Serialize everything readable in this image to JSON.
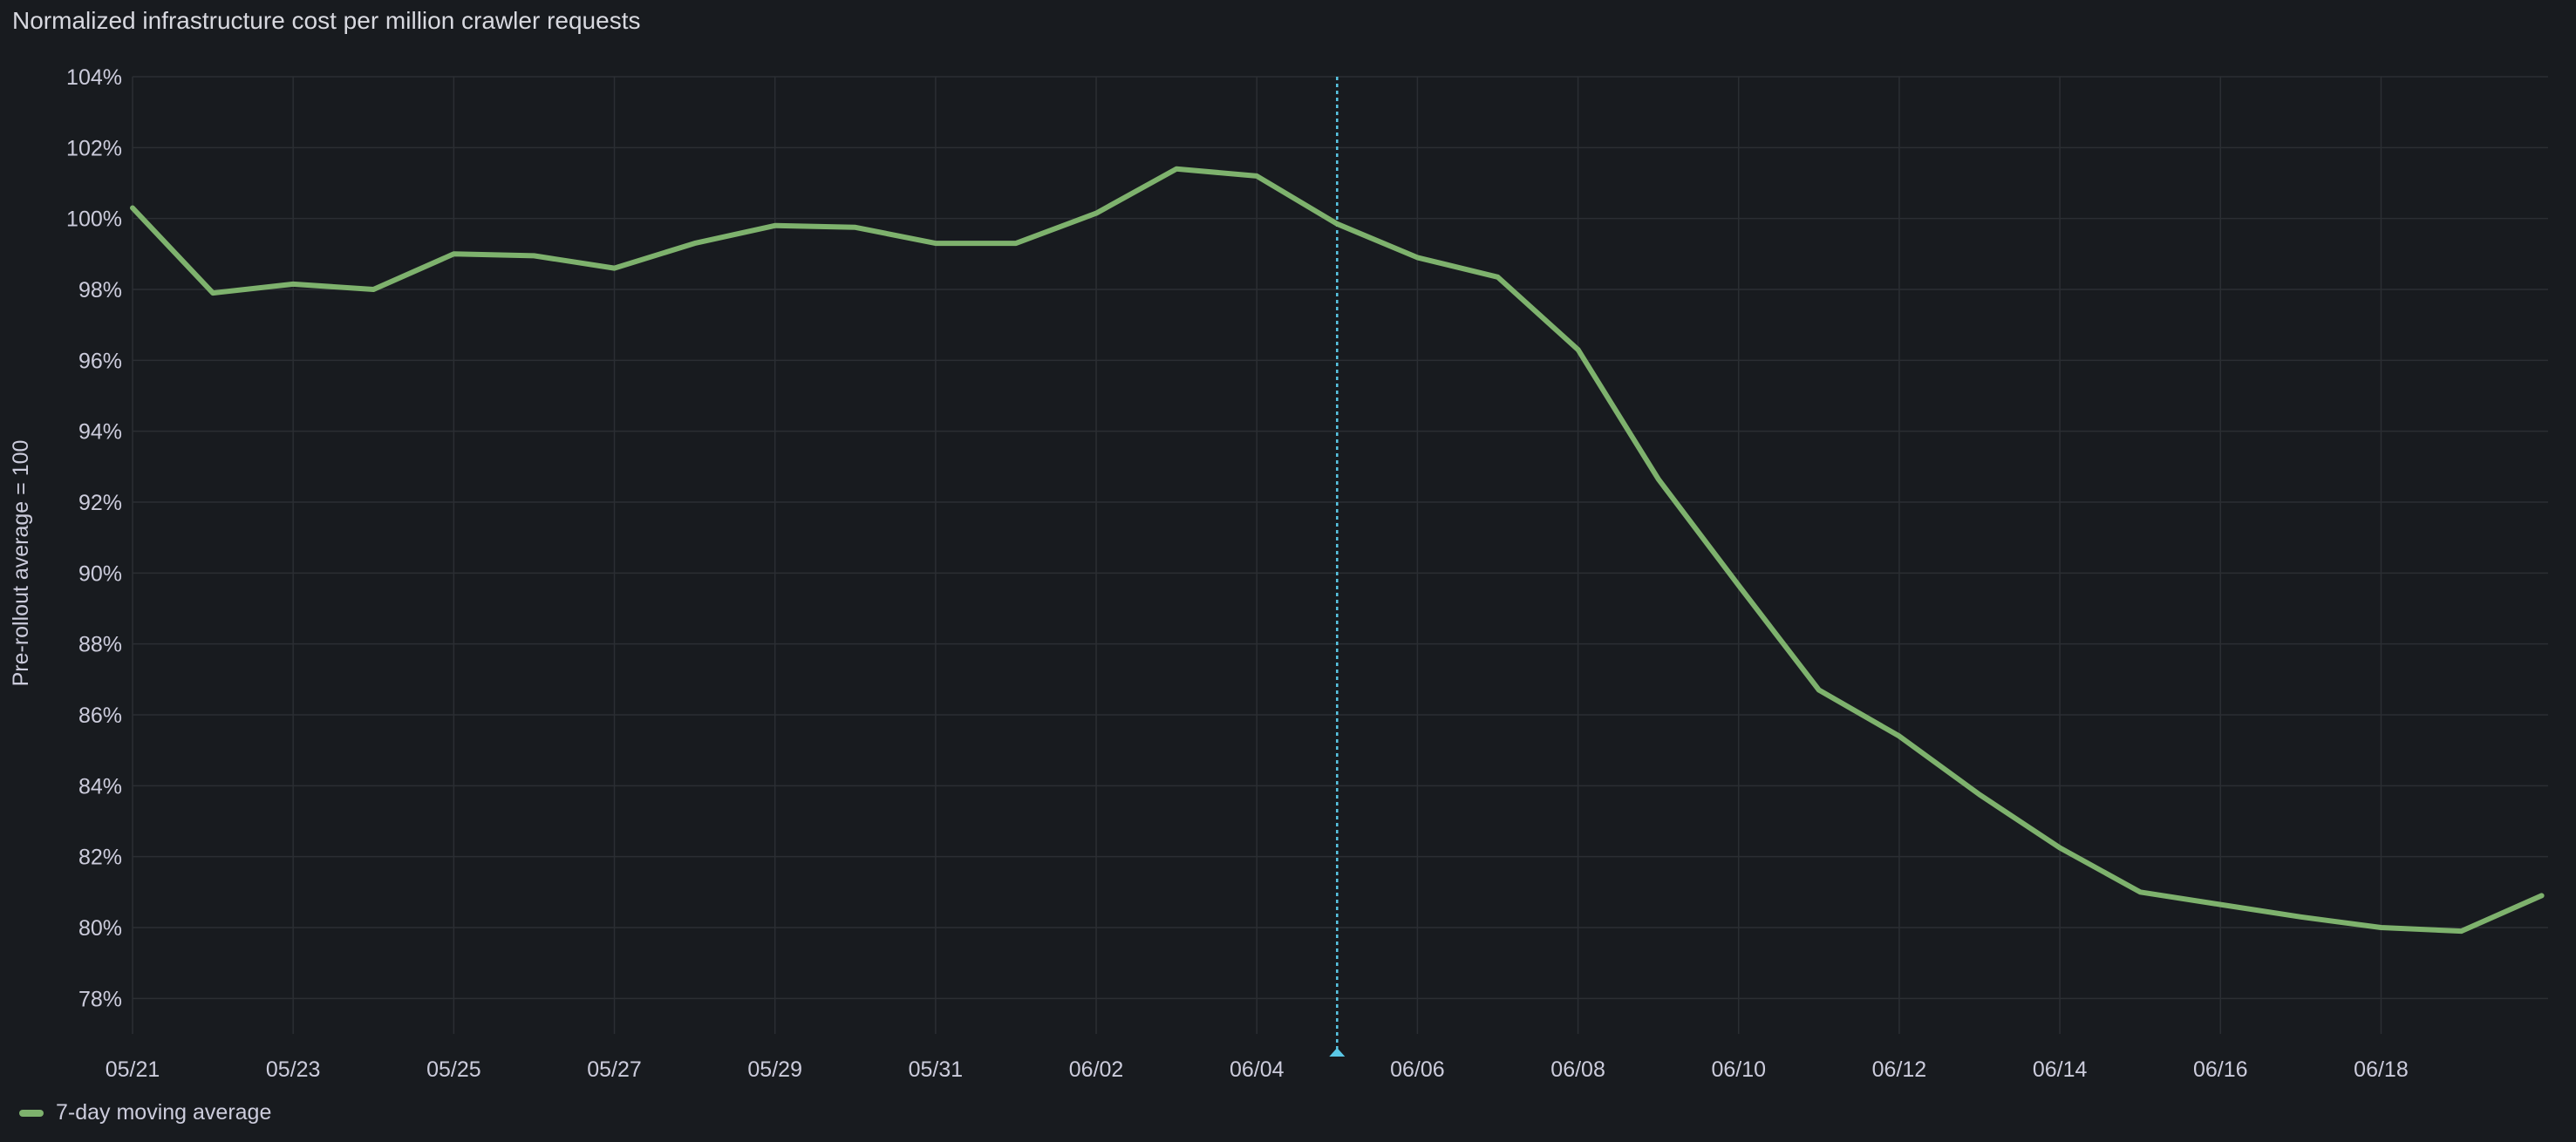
{
  "panel": {
    "title": "Normalized infrastructure cost per million crawler requests"
  },
  "colors": {
    "background": "#181b1f",
    "grid": "#2b2e33",
    "text": "#ccccdc",
    "series": "#7eb26d",
    "annotation": "#5ac8e6"
  },
  "chart_data": {
    "type": "line",
    "title": "Normalized infrastructure cost per million crawler requests",
    "ylabel": "Pre-rollout average = 100",
    "xlabel": "",
    "ylim": [
      77,
      104
    ],
    "y_ticks": [
      78,
      80,
      82,
      84,
      86,
      88,
      90,
      92,
      94,
      96,
      98,
      100,
      102,
      104
    ],
    "y_tick_suffix": "%",
    "x_tick_labels": [
      "05/21",
      "05/23",
      "05/25",
      "05/27",
      "05/29",
      "05/31",
      "06/02",
      "06/04",
      "06/06",
      "06/08",
      "06/10",
      "06/12",
      "06/14",
      "06/16",
      "06/18"
    ],
    "x_tick_indices": [
      0,
      2,
      4,
      6,
      8,
      10,
      12,
      14,
      16,
      18,
      20,
      22,
      24,
      26,
      28
    ],
    "x": [
      "05/21",
      "05/22",
      "05/23",
      "05/24",
      "05/25",
      "05/26",
      "05/27",
      "05/28",
      "05/29",
      "05/30",
      "05/31",
      "06/01",
      "06/02",
      "06/03",
      "06/04",
      "06/05",
      "06/06",
      "06/07",
      "06/08",
      "06/09",
      "06/10",
      "06/11",
      "06/12",
      "06/13",
      "06/14",
      "06/15",
      "06/16",
      "06/17",
      "06/18",
      "06/19",
      "06/20"
    ],
    "series": [
      {
        "name": "7-day moving average",
        "values": [
          100.3,
          97.9,
          98.15,
          98.0,
          99.0,
          98.95,
          98.6,
          99.3,
          99.8,
          99.75,
          99.3,
          99.3,
          100.15,
          101.4,
          101.2,
          99.85,
          98.9,
          98.35,
          96.3,
          92.65,
          89.65,
          86.7,
          85.4,
          83.75,
          82.25,
          81.0,
          80.65,
          80.3,
          80.0,
          79.9,
          80.9
        ]
      }
    ],
    "annotations": [
      {
        "x": "06/05 00:00",
        "style": "dashed-vertical"
      }
    ],
    "grid": true,
    "legend": "bottom-left"
  },
  "legend": {
    "items": [
      {
        "label": "7-day moving average"
      }
    ]
  }
}
